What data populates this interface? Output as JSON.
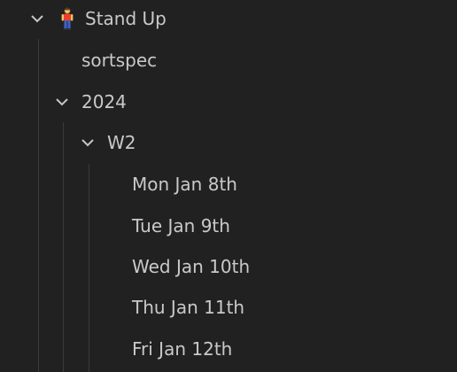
{
  "tree": {
    "root": {
      "label": "Stand Up",
      "icon": "person-standing-icon",
      "expanded": true,
      "children": {
        "sortspec": {
          "label": "sortspec"
        },
        "year": {
          "label": "2024",
          "expanded": true,
          "week": {
            "label": "W2",
            "expanded": true,
            "days": [
              {
                "label": "Mon Jan 8th"
              },
              {
                "label": "Tue Jan 9th"
              },
              {
                "label": "Wed Jan 10th"
              },
              {
                "label": "Thu Jan 11th"
              },
              {
                "label": "Fri Jan 12th"
              }
            ]
          }
        }
      }
    }
  },
  "colors": {
    "background": "#212121",
    "text": "#c9c9c9",
    "indent_guide": "#3b3b3b",
    "chevron": "#c6c6c6"
  }
}
